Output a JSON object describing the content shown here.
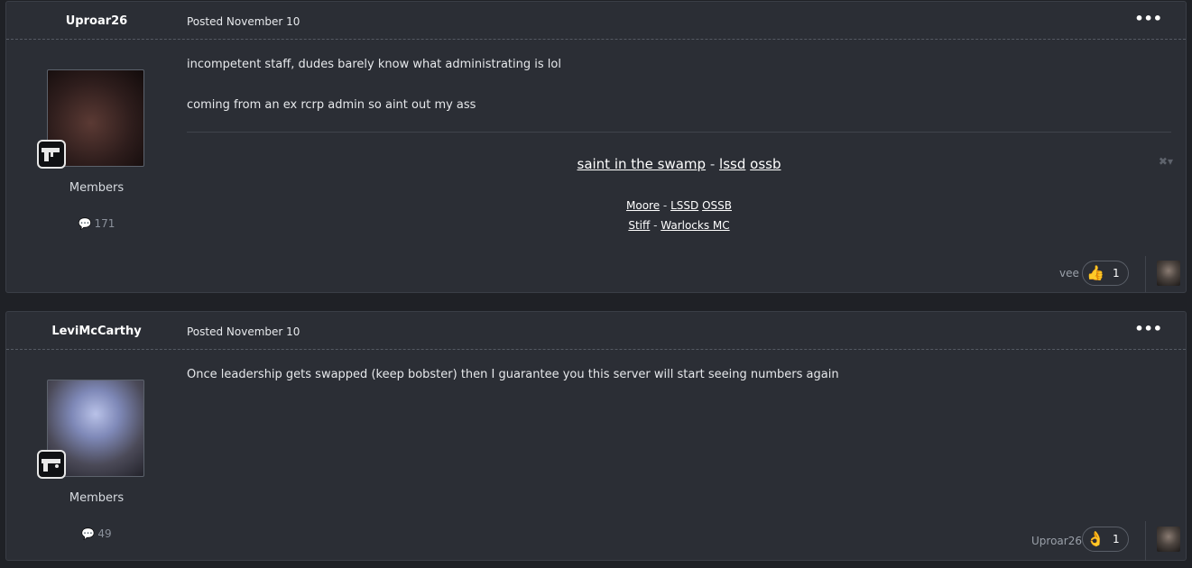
{
  "posts": [
    {
      "author": "Uproar26",
      "posted": "Posted November 10",
      "group": "Members",
      "post_count": "171",
      "content": [
        "incompetent staff, dudes barely know what administrating is lol",
        "coming from an ex rcrp admin so aint out my ass"
      ],
      "signature": {
        "line1": [
          "saint in the swamp",
          " - ",
          "lssd",
          " ",
          "ossb"
        ],
        "line2": [
          "Moore",
          " - ",
          "LSSD",
          " ",
          "OSSB"
        ],
        "line3": [
          "Stiff",
          " - ",
          "Warlocks MC"
        ]
      },
      "reaction": {
        "user": "vee",
        "emoji": "👍",
        "count": "1"
      }
    },
    {
      "author": "LeviMcCarthy",
      "posted": "Posted November 10",
      "group": "Members",
      "post_count": "49",
      "content": [
        "Once leadership gets swapped (keep bobster) then I guarantee you this server will start seeing numbers again"
      ],
      "reaction": {
        "user": "Uproar26",
        "emoji": "👌",
        "count": "1"
      }
    }
  ],
  "icons": {
    "menu": "ellipsis-icon",
    "comment": "comment-icon",
    "signature_controls": "close-icon",
    "rank": "gun-badge-icon"
  },
  "colors": {
    "background": "#1f2126",
    "panel": "#2b2e35",
    "text": "#e6e8eb",
    "muted": "#8b919b"
  }
}
